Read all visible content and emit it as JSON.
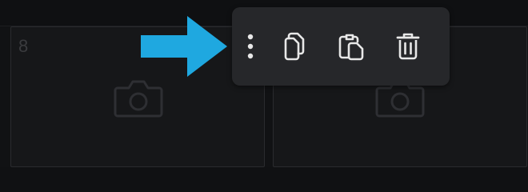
{
  "grid": {
    "slots": [
      {
        "number": "8",
        "icon": "camera-icon"
      },
      {
        "number": "",
        "icon": "camera-icon"
      }
    ]
  },
  "pointer": {
    "icon": "arrow-right-icon",
    "color": "#1fa8e0"
  },
  "toolbar": {
    "items": [
      {
        "name": "more-options",
        "icon": "vertical-dots-icon"
      },
      {
        "name": "copy",
        "icon": "copy-icon"
      },
      {
        "name": "paste",
        "icon": "paste-icon"
      },
      {
        "name": "delete",
        "icon": "trash-icon"
      }
    ]
  },
  "colors": {
    "background": "#111214",
    "card": "#161719",
    "toolbar": "#26272a",
    "icon": "#e8e8e8",
    "accent": "#1fa8e0"
  }
}
